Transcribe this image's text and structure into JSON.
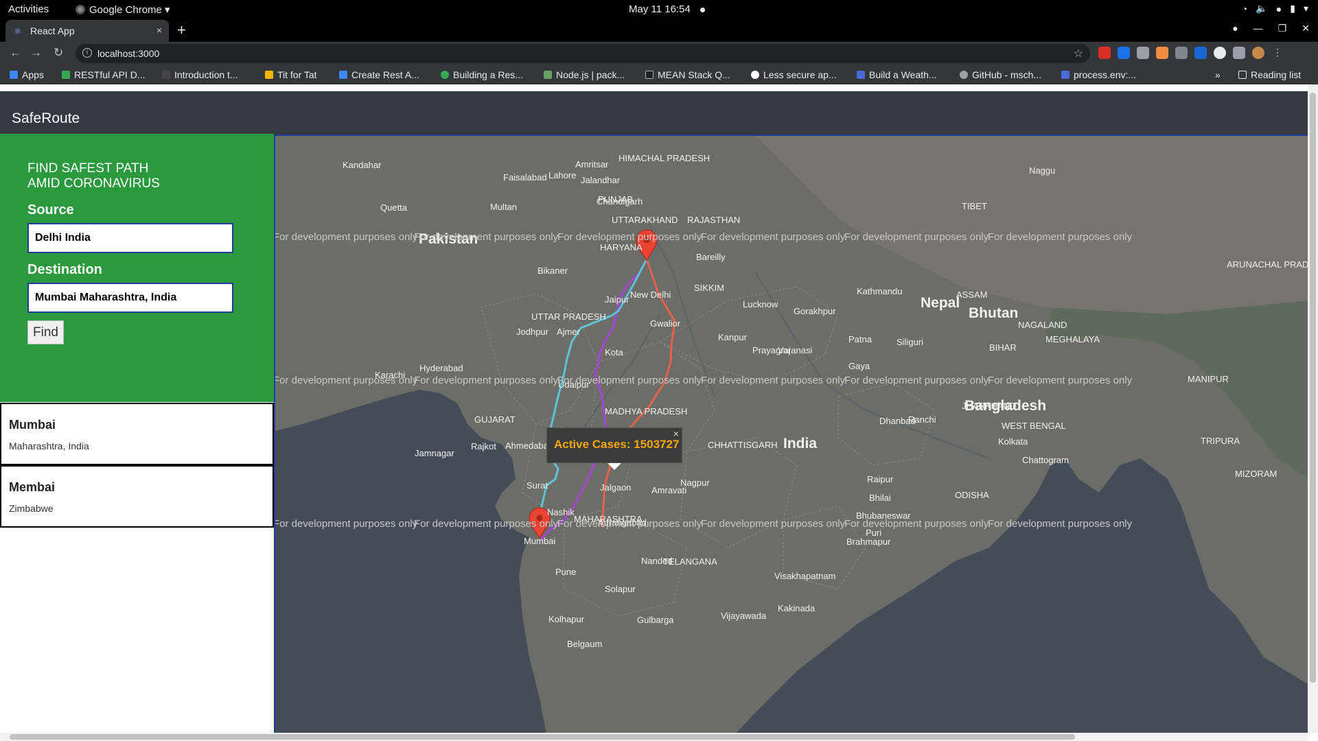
{
  "os_bar": {
    "activities": "Activities",
    "app_name": "Google Chrome ▾",
    "clock": "May 11  16:54"
  },
  "browser": {
    "tab_title": "React App",
    "tab_close": "×",
    "new_tab": "+",
    "url": "localhost:3000",
    "bookmarks": [
      "Apps",
      "RESTful API D...",
      "Introduction t...",
      "Tit for Tat",
      "Create Rest A...",
      "Building a Res...",
      "Node.js | pack...",
      "MEAN Stack Q...",
      "Less secure ap...",
      "Build a Weath...",
      "GitHub - msch...",
      "process.env:..."
    ],
    "more": "»",
    "reading_list": "Reading list"
  },
  "app": {
    "brand": "SafeRoute",
    "heading_line1": "FIND SAFEST PATH",
    "heading_line2": "AMID CORONAVIRUS",
    "source_label": "Source",
    "source_value": "Delhi India",
    "destination_label": "Destination",
    "destination_value": "Mumbai Maharashtra, India",
    "find_label": "Find",
    "results": [
      {
        "title": "Mumbai",
        "subtitle": "Maharashtra, India"
      },
      {
        "title": "Membai",
        "subtitle": "Zimbabwe"
      }
    ]
  },
  "map": {
    "watermark": "For development purposes only",
    "popup_text": "Active Cases: 1503727",
    "popup_close": "×",
    "labels": {
      "countries": [
        "Pakistan",
        "Nepal",
        "Bhutan",
        "India",
        "Bangladesh"
      ],
      "cities": [
        "Kandahar",
        "Quetta",
        "Faisalabad",
        "Lahore",
        "Multan",
        "Amritsar",
        "Jalandhar",
        "Chandigarh",
        "Bikaner",
        "Jaipur",
        "Jodhpur",
        "Ajmer",
        "Kota",
        "Udaipur",
        "Karachi",
        "Hyderabad",
        "Gwalior",
        "Kanpur",
        "Lucknow",
        "Bareilly",
        "Kathmandu",
        "Gorakhpur",
        "Prayagraj",
        "Varanasi",
        "Patna",
        "Gaya",
        "Dhanbad",
        "Ranchi",
        "Kolkata",
        "Chattogram",
        "Rajkot",
        "Ahmedabad",
        "Jamnagar",
        "Surat",
        "Indore",
        "Nashik",
        "Jalgaon",
        "Aurangabad",
        "Amravati",
        "Nagpur",
        "Raipur",
        "Bhilai",
        "Pune",
        "Solapur",
        "Nanded",
        "Kolhapur",
        "Belgaum",
        "Gulbarga",
        "Vijayawada",
        "Visakhapatnam",
        "Kakinada",
        "Bhubaneswar",
        "Brahmapur",
        "Puri",
        "Siliguri",
        "Naggu",
        "New Delhi",
        "Mumbai"
      ],
      "regions": [
        "HIMACHAL PRADESH",
        "PUNJAB",
        "HARYANA",
        "UTTARAKHAND",
        "RAJASTHAN",
        "UTTAR PRADESH",
        "SIKKIM",
        "ASSAM",
        "NAGALAND",
        "MEGHALAYA",
        "BIHAR",
        "JHARKHAND",
        "WEST BENGAL",
        "GUJARAT",
        "MADHYA PRADESH",
        "CHHATTISGARH",
        "ODISHA",
        "MAHARASHTRA",
        "TELANGANA",
        "TIBET",
        "ARUNACHAL PRADESH",
        "MANIPUR",
        "MIZORAM",
        "TRIPURA"
      ]
    },
    "colors": {
      "route_orange": "#e4634a",
      "route_purple": "#a544d6",
      "route_cyan": "#5bc4d6",
      "marker": "#ea4335",
      "popup_text": "#f6a800"
    }
  }
}
